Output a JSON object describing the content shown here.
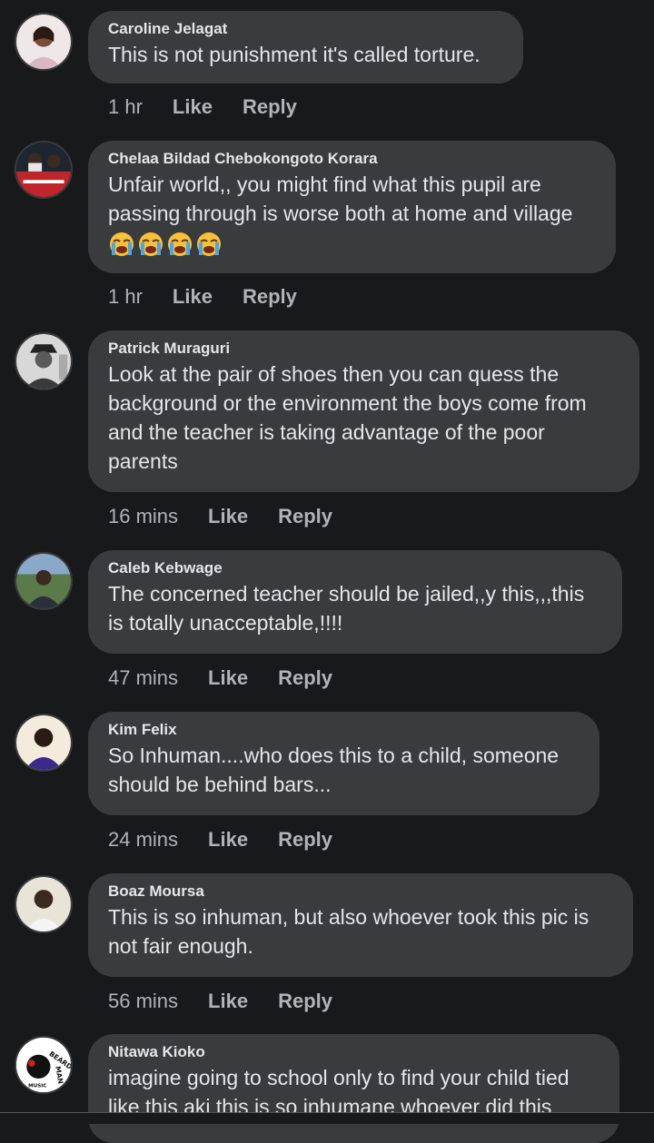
{
  "comments": [
    {
      "author": "Caroline Jelagat",
      "text": "This is not punishment it's called torture.",
      "time": "1 hr",
      "like": "Like",
      "reply": "Reply"
    },
    {
      "author": "Chelaa Bildad Chebokongoto Korara",
      "text": "Unfair world,, you might find what this pupil are passing through is worse both at home and village",
      "time": "1 hr",
      "like": "Like",
      "reply": "Reply"
    },
    {
      "author": "Patrick Muraguri",
      "text": "Look at the pair of shoes  then you can quess  the background or the environment  the boys come from and the teacher is taking  advantage of the poor parents",
      "time": "16 mins",
      "like": "Like",
      "reply": "Reply"
    },
    {
      "author": "Caleb Kebwage",
      "text": "The concerned teacher should be jailed,,y this,,,this is totally unacceptable,!!!!",
      "time": "47 mins",
      "like": "Like",
      "reply": "Reply"
    },
    {
      "author": "Kim Felix",
      "text": "So Inhuman....who does this to a child, someone should be behind bars...",
      "time": "24 mins",
      "like": "Like",
      "reply": "Reply"
    },
    {
      "author": "Boaz Moursa",
      "text": "This is so inhuman, but also whoever took this pic is not fair enough.",
      "time": "56 mins",
      "like": "Like",
      "reply": "Reply"
    },
    {
      "author": "Nitawa Kioko",
      "text": "imagine going to school only to find your child tied like this aki this is so inhumane whoever did this"
    }
  ],
  "emoji_icon": "loudly-crying-face-icon",
  "avatar_logo_text": [
    "BEARD",
    "MAN",
    "MUSIC"
  ],
  "colors": {
    "background": "#18191a",
    "bubble": "#3a3b3c",
    "text": "#e4e6eb",
    "muted": "#b0b3b8"
  }
}
